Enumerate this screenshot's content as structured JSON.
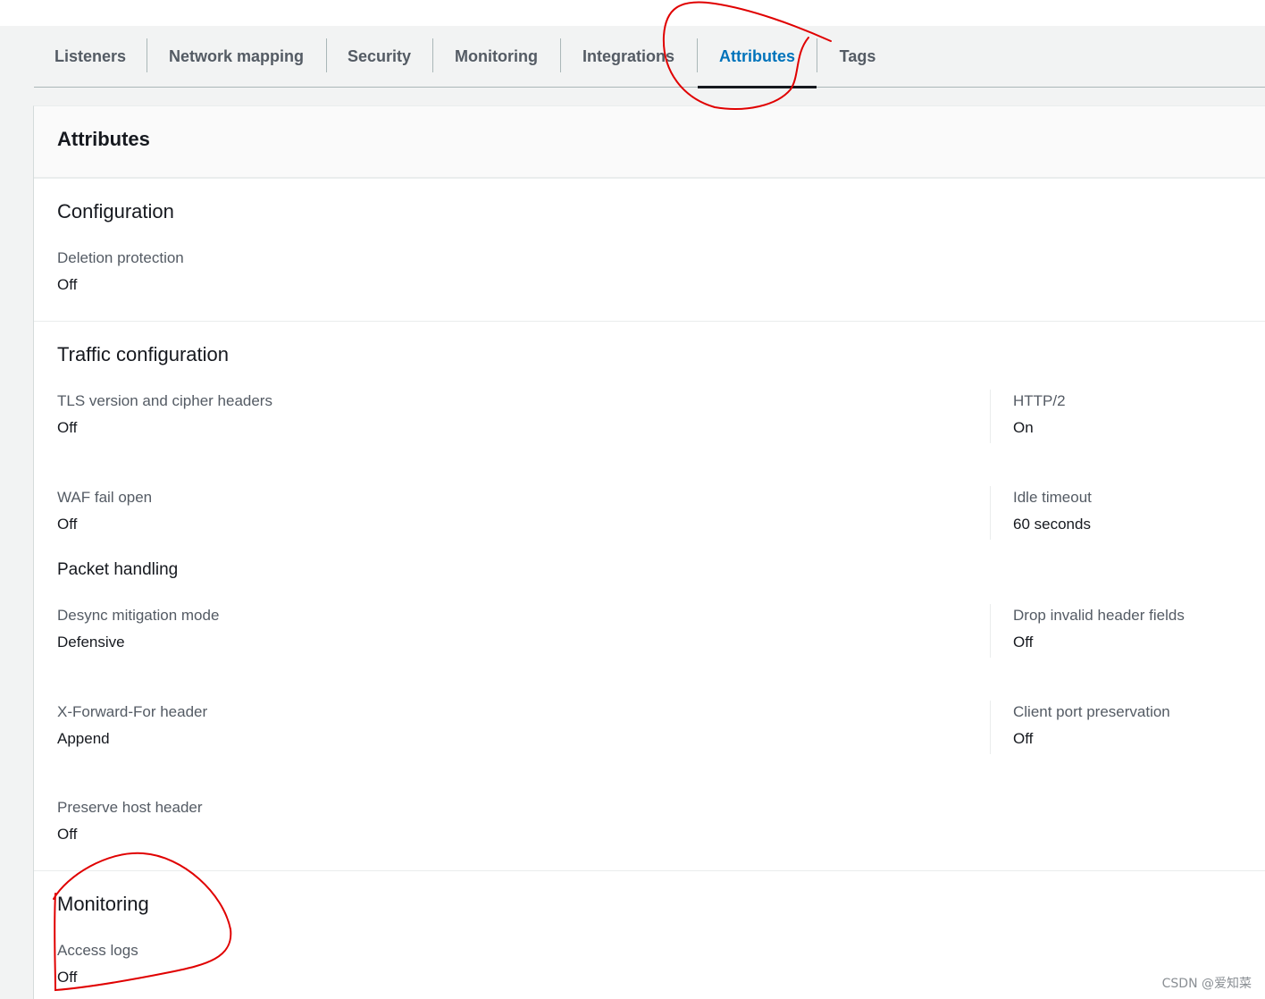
{
  "tabs": [
    {
      "label": "Listeners",
      "active": false
    },
    {
      "label": "Network mapping",
      "active": false
    },
    {
      "label": "Security",
      "active": false
    },
    {
      "label": "Monitoring",
      "active": false
    },
    {
      "label": "Integrations",
      "active": false
    },
    {
      "label": "Attributes",
      "active": true
    },
    {
      "label": "Tags",
      "active": false
    }
  ],
  "panel": {
    "title": "Attributes",
    "configuration": {
      "title": "Configuration",
      "deletion_protection": {
        "label": "Deletion protection",
        "value": "Off"
      }
    },
    "traffic": {
      "title": "Traffic configuration",
      "tls": {
        "label": "TLS version and cipher headers",
        "value": "Off"
      },
      "http2": {
        "label": "HTTP/2",
        "value": "On"
      },
      "waf": {
        "label": "WAF fail open",
        "value": "Off"
      },
      "idle": {
        "label": "Idle timeout",
        "value": "60 seconds"
      },
      "packet_title": "Packet handling",
      "desync": {
        "label": "Desync mitigation mode",
        "value": "Defensive"
      },
      "drop_invalid": {
        "label": "Drop invalid header fields",
        "value": "Off"
      },
      "xff": {
        "label": "X-Forward-For header",
        "value": "Append"
      },
      "client_port": {
        "label": "Client port preservation",
        "value": "Off"
      },
      "preserve_host": {
        "label": "Preserve host header",
        "value": "Off"
      }
    },
    "monitoring": {
      "title": "Monitoring",
      "access_logs": {
        "label": "Access logs",
        "value": "Off"
      }
    }
  },
  "watermark": "CSDN @爱知菜",
  "colors": {
    "active_tab": "#0073bb",
    "annotation": "#e00000"
  }
}
